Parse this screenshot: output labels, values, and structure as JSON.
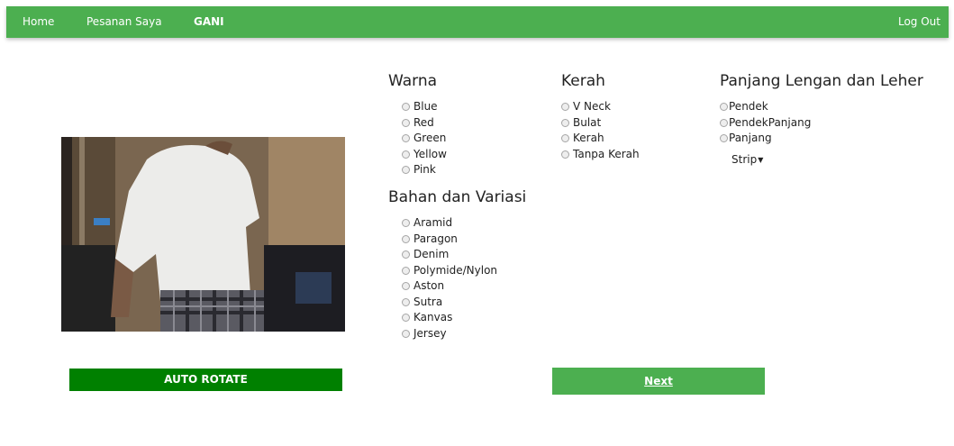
{
  "nav": {
    "home": "Home",
    "orders": "Pesanan Saya",
    "user": "GANI",
    "logout": "Log Out"
  },
  "colors": {
    "nav_bg": "#4caf50",
    "auto_btn_bg": "#008000",
    "next_btn_bg": "#4caf50"
  },
  "warna": {
    "title": "Warna",
    "options": [
      "Blue",
      "Red",
      "Green",
      "Yellow",
      "Pink"
    ]
  },
  "kerah": {
    "title": "Kerah",
    "options": [
      "V Neck",
      "Bulat",
      "Kerah",
      "Tanpa Kerah"
    ]
  },
  "lengan": {
    "title": "Panjang Lengan dan Leher",
    "options": [
      "Pendek",
      "PendekPanjang",
      "Panjang"
    ],
    "dropdown": "Strip"
  },
  "bahan": {
    "title": "Bahan dan Variasi",
    "options": [
      "Aramid",
      "Paragon",
      "Denim",
      "Polymide/Nylon",
      "Aston",
      "Sutra",
      "Kanvas",
      "Jersey"
    ]
  },
  "buttons": {
    "auto_rotate": "AUTO ROTATE",
    "next": "Next"
  }
}
